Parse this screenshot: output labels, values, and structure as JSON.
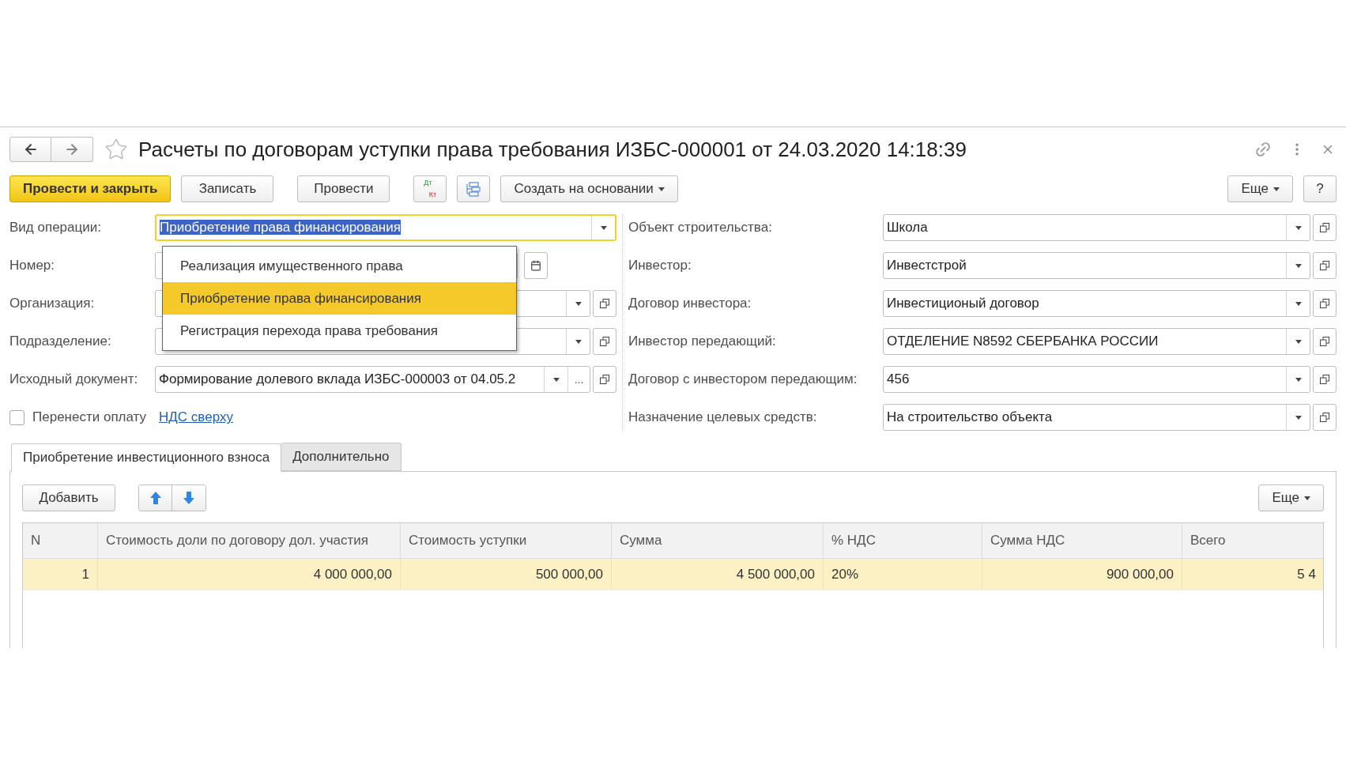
{
  "window": {
    "title": "Расчеты по договорам уступки права требования ИЗБС-000001 от 24.03.2020 14:18:39"
  },
  "toolbar": {
    "buttons": [
      {
        "kind": "primary",
        "label": "Провести и закрыть"
      },
      {
        "kind": "plain",
        "label": "Записать"
      },
      {
        "kind": "plain",
        "label": "Провести"
      },
      {
        "kind": "dtkt",
        "labels": [
          "Дт",
          "Кт"
        ]
      },
      {
        "kind": "structure"
      },
      {
        "kind": "menu",
        "label": "Создать на основании"
      }
    ],
    "right_buttons": [
      {
        "kind": "menu",
        "label": "Еще"
      },
      {
        "kind": "plain",
        "label": "?"
      }
    ]
  },
  "left_fields": [
    {
      "label": "Вид операции:",
      "value": "Приобретение права финансирования",
      "kind": "select",
      "focused": true
    },
    {
      "label": "Номер:",
      "kind": "date",
      "focused": false
    },
    {
      "label": "Организация:",
      "kind": "select_open",
      "focused": false
    },
    {
      "label": "Подразделение:",
      "kind": "select_open",
      "focused": false
    },
    {
      "label": "Исходный документ:",
      "value": "Формирование долевого вклада ИЗБС-000003 от 04.05.2",
      "kind": "select_choose_open",
      "choose_button": "...",
      "focused": false
    }
  ],
  "dropdown": {
    "options": [
      {
        "label": "Реализация имущественного права",
        "selected": false
      },
      {
        "label": "Приобретение права финансирования",
        "selected": true
      },
      {
        "label": "Регистрация перехода права требования",
        "selected": false
      }
    ]
  },
  "checkbox": {
    "label": "Перенести оплату",
    "checked": false
  },
  "link": "НДС сверху",
  "right_fields": [
    {
      "label": "Объект строительства:",
      "value": "Школа",
      "kind": "select_open",
      "focused": false
    },
    {
      "label": "Инвестор:",
      "value": "Инвестстрой",
      "kind": "select_open",
      "focused": false
    },
    {
      "label": "Договор инвестора:",
      "value": "Инвестиционый договор",
      "kind": "select_open",
      "focused": false
    },
    {
      "label": "Инвестор передающий:",
      "value": "ОТДЕЛЕНИЕ N8592 СБЕРБАНКА РОССИИ",
      "kind": "select_open",
      "focused": false
    },
    {
      "label": "Договор с инвестором передающим:",
      "value": "456",
      "kind": "select_open",
      "focused": false
    },
    {
      "label": "Назначение целевых средств:",
      "value": "На строительство объекта",
      "kind": "select_open",
      "focused": false
    }
  ],
  "tabs": [
    {
      "label": "Приобретение инвестиционного взноса",
      "selected": true
    },
    {
      "label": "Дополнительно",
      "selected": false
    }
  ],
  "table_toolbar": {
    "add_button": "Добавить",
    "more_button": "Еще"
  },
  "table": {
    "columns": [
      {
        "label": "N",
        "kind": "number"
      },
      {
        "label": "Стоимость доли по договору дол. участия",
        "kind": "number"
      },
      {
        "label": "Стоимость уступки",
        "kind": "number"
      },
      {
        "label": "Сумма",
        "kind": "number"
      },
      {
        "label": "% НДС",
        "kind": "text"
      },
      {
        "label": "Сумма НДС",
        "kind": "number"
      },
      {
        "label": "Всего",
        "kind": "number"
      }
    ],
    "rows": [
      {
        "selected": true,
        "cells": [
          "1",
          "4 000 000,00",
          "500 000,00",
          "4 500 000,00",
          "20%",
          "900 000,00",
          "5 4"
        ]
      }
    ]
  }
}
